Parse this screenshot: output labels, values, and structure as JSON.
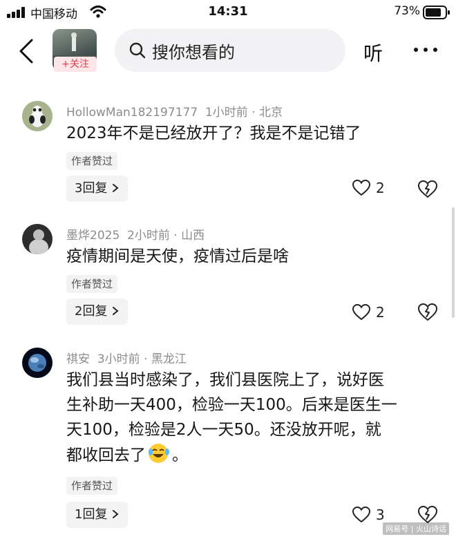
{
  "status_bar": {
    "carrier": "中国移动",
    "time": "14:31",
    "battery": "73%"
  },
  "header": {
    "follow_label": "+关注",
    "search_placeholder": "搜你想看的",
    "listen_label": "听"
  },
  "comments": [
    {
      "user": "HollowMan182197177",
      "time": "1小时前",
      "location": "北京",
      "text": "2023年不是已经放开了？我是不是记错了",
      "badge": "作者赞过",
      "replies": "3回复",
      "likes": "2"
    },
    {
      "user": "墨烨2025",
      "time": "2小时前",
      "location": "山西",
      "text": "疫情期间是天使，疫情过后是啥",
      "badge": "作者赞过",
      "replies": "2回复",
      "likes": "2"
    },
    {
      "user": "祺安",
      "time": "3小时前",
      "location": "黑龙江",
      "text_lines": [
        "我们县当时感染了，我们县医院上了，说好医",
        "生补助一天400，检验一天100。后来是医生一",
        "天100，检验是2人一天50。还没放开呢，就",
        "都收回去了"
      ],
      "text_end": "。",
      "badge": "作者赞过",
      "replies": "1回复",
      "likes": "3"
    }
  ],
  "meta_separator": "·",
  "watermark": "网易号 | 火山诗话",
  "colors": {
    "follow_text": "#e83a4c",
    "follow_bg": "#fde6e8",
    "meta": "#8c8c8c"
  },
  "icons": [
    "back-icon",
    "search-icon",
    "more-icon",
    "chevron-right-icon",
    "heart-icon",
    "dislike-heart-icon",
    "laugh-cry-emoji",
    "signal-icon",
    "wifi-icon",
    "battery-icon"
  ]
}
